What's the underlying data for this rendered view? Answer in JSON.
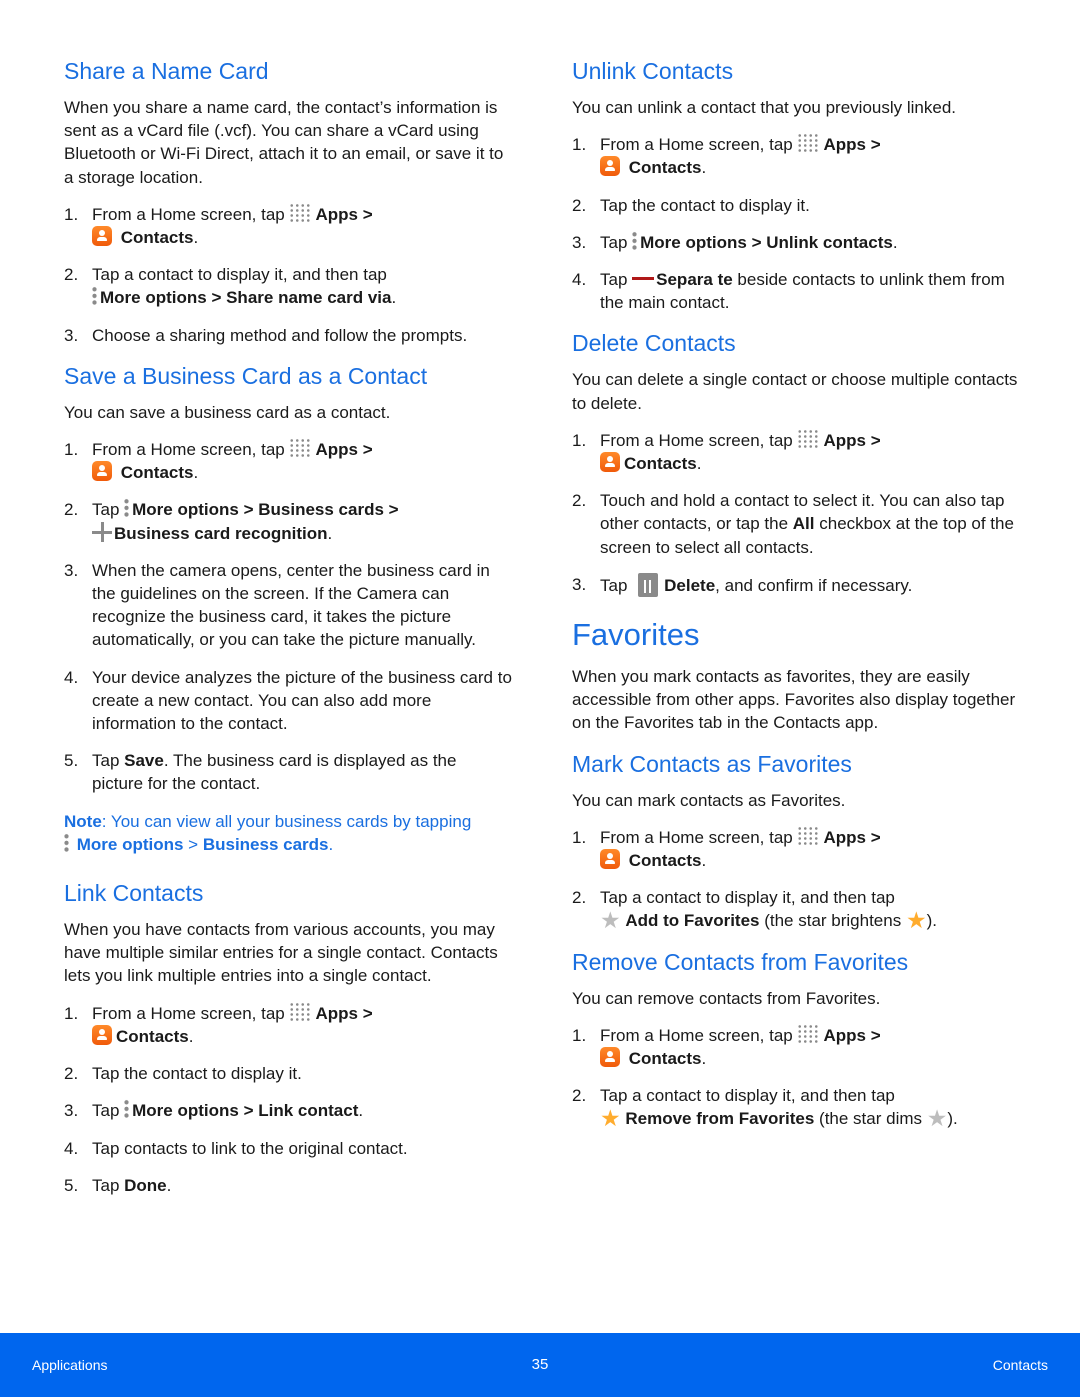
{
  "left": {
    "share": {
      "title": "Share a Name Card",
      "intro": "When you share a name card, the contact’s information is sent as a vCard file (.vcf). You can share a vCard using Bluetooth or Wi-Fi Direct, attach it to an email, or save it to a storage location.",
      "step1": {
        "num": "1.",
        "pre": "From a Home screen, tap ",
        "apps": "Apps",
        "sep": " >",
        "contacts": "Contacts",
        "end": "."
      },
      "step2": {
        "num": "2.",
        "pre": "Tap a contact to display it, and then tap ",
        "more": "More options",
        "sep": " > ",
        "target": "Share name card via",
        "end": "."
      },
      "step3": {
        "num": "3.",
        "text": "Choose a sharing method and follow the prompts."
      }
    },
    "business": {
      "title": "Save a Business Card as a Contact",
      "intro": "You can save a business card as a contact.",
      "step1": {
        "num": "1.",
        "pre": "From a Home screen, tap ",
        "apps": "Apps",
        "sep": " >",
        "contacts": "Contacts",
        "end": "."
      },
      "step2": {
        "num": "2.",
        "pre": "Tap ",
        "more": "More options",
        "sep": " > ",
        "cards": "Business cards",
        "sep2": " >",
        "recog": "Business card recognition",
        "end": "."
      },
      "step3": {
        "num": "3.",
        "text": "When the camera opens, center the business card in the guidelines on the screen. If the Camera can recognize the business card, it takes the picture automatically, or you can take the picture manually."
      },
      "step4": {
        "num": "4.",
        "text": "Your device analyzes the picture of the business card to create a new contact. You can also add more information to the contact."
      },
      "step5": {
        "num": "5.",
        "pre": "Tap ",
        "save": "Save",
        "post": ". The business card is displayed as the picture for the contact."
      },
      "note": {
        "label": "Note",
        "text": ": You can view all your business cards by tapping ",
        "more": "More options",
        "sep": " > ",
        "cards": "Business cards",
        "end": "."
      }
    },
    "link": {
      "title": "Link Contacts",
      "intro": "When you have contacts from various accounts, you may have multiple similar entries for a single contact. Contacts lets you link multiple entries into a single contact.",
      "step1": {
        "num": "1.",
        "pre": "From a Home screen, tap ",
        "apps": "Apps",
        "sep": " >",
        "contacts": "Contacts",
        "end": "."
      },
      "step2": {
        "num": "2.",
        "text": "Tap the contact to display it."
      },
      "step3": {
        "num": "3.",
        "pre": "Tap ",
        "more": "More options",
        "sep": " > ",
        "target": "Link contact",
        "end": "."
      },
      "step4": {
        "num": "4.",
        "text": "Tap contacts to link to the original contact."
      },
      "step5": {
        "num": "5.",
        "pre": "Tap ",
        "done": "Done",
        "end": "."
      }
    }
  },
  "right": {
    "unlink": {
      "title": "Unlink Contacts",
      "intro": "You can unlink a contact that you previously linked.",
      "step1": {
        "num": "1.",
        "pre": "From a Home screen, tap ",
        "apps": "Apps",
        "sep": " >",
        "contacts": "Contacts",
        "end": "."
      },
      "step2": {
        "num": "2.",
        "text": "Tap the contact to display it."
      },
      "step3": {
        "num": "3.",
        "pre": "Tap ",
        "more": "More options",
        "sep": " > ",
        "target": "Unlink contacts",
        "end": "."
      },
      "step4": {
        "num": "4.",
        "pre": "Tap ",
        "separate": "Separa te",
        "post": " beside contacts to unlink them from the main contact."
      }
    },
    "delete": {
      "title": "Delete Contacts",
      "intro": "You can delete a single contact or choose multiple contacts to delete.",
      "step1": {
        "num": "1.",
        "pre": "From a Home screen, tap ",
        "apps": "Apps",
        "sep": " >",
        "contacts": "Contacts",
        "end": "."
      },
      "step2": {
        "num": "2.",
        "pre": "Touch and hold a contact to select it. You can also tap other contacts, or tap the ",
        "all": "All",
        "post": " checkbox at the top of the screen to select all contacts."
      },
      "step3": {
        "num": "3.",
        "pre": "Tap ",
        "delete": "Delete",
        "post": ", and confirm if necessary."
      }
    },
    "favorites": {
      "title": "Favorites",
      "intro": "When you mark contacts as favorites, they are easily accessible from other apps. Favorites also display together on the Favorites tab in the Contacts app."
    },
    "mark": {
      "title": "Mark Contacts as Favorites",
      "intro": "You can mark contacts as Favorites.",
      "step1": {
        "num": "1.",
        "pre": "From a Home screen, tap ",
        "apps": "Apps",
        "sep": " >",
        "contacts": "Contacts",
        "end": "."
      },
      "step2": {
        "num": "2.",
        "pre": "Tap a contact to display it, and then tap ",
        "add": "Add to Favorites",
        "post": " (the star brightens ",
        "end": ")."
      }
    },
    "remove": {
      "title": "Remove Contacts from Favorites",
      "intro": "You can remove contacts from Favorites.",
      "step1": {
        "num": "1.",
        "pre": "From a Home screen, tap ",
        "apps": "Apps",
        "sep": " >",
        "contacts": "Contacts",
        "end": "."
      },
      "step2": {
        "num": "2.",
        "pre": "Tap a contact to display it, and then tap ",
        "remove": "Remove from Favorites",
        "post": " (the star dims ",
        "end": ")."
      }
    }
  },
  "footer": {
    "left": "Applications",
    "page": "35",
    "right": "Contacts"
  },
  "icons": {
    "star": "★"
  }
}
